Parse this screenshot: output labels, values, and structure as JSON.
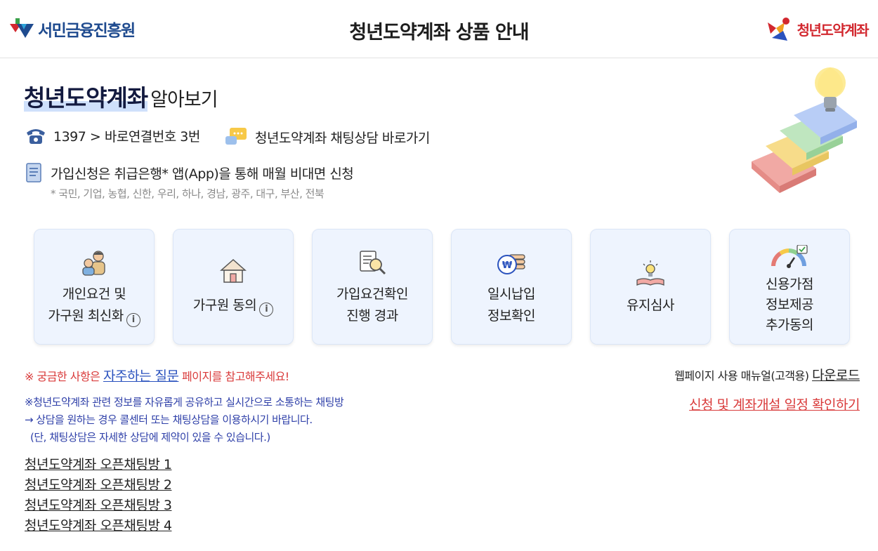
{
  "header": {
    "left_logo_text": "서민금융진흥원",
    "title": "청년도약계좌 상품 안내",
    "right_logo_text": "청년도약계좌"
  },
  "intro": {
    "title_highlight": "청년도약계좌",
    "title_rest": "알아보기",
    "phone_text": "1397 > 바로연결번호 3번",
    "chat_text": "청년도약계좌 채팅상담 바로가기",
    "apply_text": "가입신청은 취급은행* 앱(App)을 통해 매월 비대면 신청",
    "banks_note": "* 국민, 기업, 농협, 신한, 우리, 하나, 경남, 광주, 대구, 부산, 전북"
  },
  "cards": [
    {
      "line1": "개인요건 및",
      "line2": "가구원 최신화",
      "icon": "family-icon"
    },
    {
      "line1": "가구원 동의",
      "icon": "house-icon"
    },
    {
      "line1": "가입요건확인",
      "line2": "진행 경과",
      "icon": "document-search-icon"
    },
    {
      "line1": "일시납입",
      "line2": "정보확인",
      "icon": "won-coins-icon"
    },
    {
      "line1": "유지심사",
      "icon": "book-lightbulb-icon"
    },
    {
      "line1": "신용가점",
      "line2": "정보제공",
      "line3": "추가동의",
      "icon": "credit-gauge-icon"
    }
  ],
  "info_icon_glyph": "i",
  "notices": {
    "faq_prefix": "※ 궁금한 사항은",
    "faq_link": "자주하는 질문",
    "faq_suffix": "페이지를 참고해주세요!",
    "manual_prefix": "웹페이지 사용 매뉴얼(고객용)",
    "manual_link": "다운로드",
    "schedule_link": "신청 및 계좌개설 일정 확인하기",
    "chat_note1": "※청년도약계좌 관련 정보를 자유롭게 공유하고 실시간으로 소통하는 채팅방",
    "chat_note2": "→ 상담을 원하는 경우 콜센터 또는 채팅상담을 이용하시기 바랍니다.",
    "chat_note3": "(단, 채팅상담은 자세한 상담에 제약이 있을 수 있습니다.)"
  },
  "open_chats": [
    "청년도약계좌 오픈채팅방 1",
    "청년도약계좌 오픈채팅방 2",
    "청년도약계좌 오픈채팅방 3",
    "청년도약계좌 오픈채팅방 4"
  ],
  "colors": {
    "brand_blue": "#1f4b8f",
    "brand_red": "#d2282f",
    "card_bg": "#eef4fe",
    "notice_red": "#d93a3a",
    "notice_blue": "#2e3fa8"
  }
}
